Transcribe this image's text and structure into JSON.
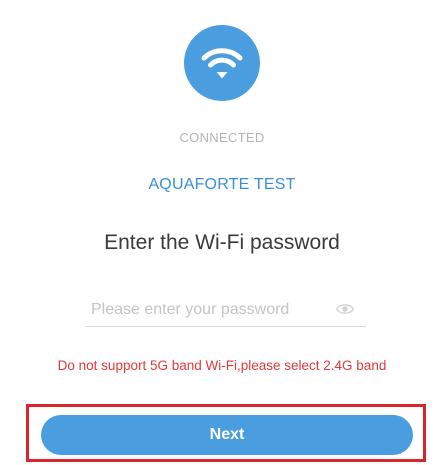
{
  "connection": {
    "status": "CONNECTED",
    "network_name": "AQUAFORTE TEST",
    "icon": "wifi-icon"
  },
  "password_section": {
    "title": "Enter the Wi-Fi password",
    "placeholder": "Please enter your password",
    "value": "",
    "toggle_icon": "eye-icon"
  },
  "warning": "Do not support 5G band Wi-Fi,please select 2.4G band",
  "actions": {
    "next_label": "Next"
  },
  "colors": {
    "accent": "#4a9ee0",
    "network_name": "#3a8fd8",
    "warning": "#e23a3a",
    "highlight_border": "#d9252c",
    "status": "#b4b4b4"
  }
}
